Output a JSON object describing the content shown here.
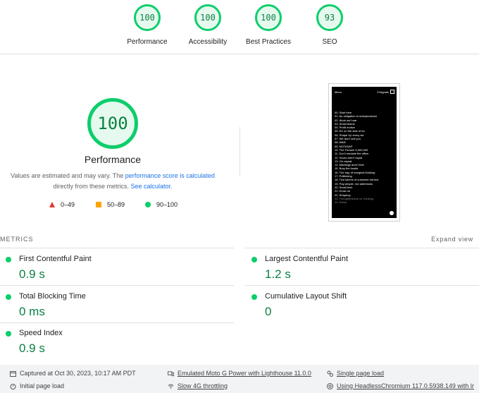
{
  "categories": [
    {
      "score": "100",
      "label": "Performance"
    },
    {
      "score": "100",
      "label": "Accessibility"
    },
    {
      "score": "100",
      "label": "Best Practices"
    },
    {
      "score": "93",
      "label": "SEO"
    }
  ],
  "performance": {
    "score": "100",
    "title": "Performance",
    "disclaimer_pre": "Values are estimated and may vary. The ",
    "disclaimer_link1": "performance score is calculated",
    "disclaimer_mid": " directly from these metrics. ",
    "disclaimer_link2": "See calculator.",
    "legend": [
      {
        "range": "0–49",
        "color": "#e53935"
      },
      {
        "range": "50–89",
        "color": "#ffa400"
      },
      {
        "range": "90–100",
        "color": "#0cce6b"
      }
    ]
  },
  "screenshot": {
    "menu": "Menu",
    "brand": "37signals",
    "items": [
      "00. Start here",
      "01. An obligation to independence",
      "02. Work isn't war",
      "03. Small teams",
      "04. Profit motive",
      "05. Err on the side of do",
      "06. Shape Up every six",
      "07. We don't sell you",
      "08. 8/8/8",
      "09. NOTASAP",
      "10. The Fortune 5,000,000",
      "11. Don't emulate the office",
      "12. Hours aren't equal",
      "13. On repeat",
      "14. Meetings aren't free",
      "15. Bury the hustle",
      "16. The trap of marginal thinking",
      "17. Politicking",
      "18. Two tokens of customer service",
      "19. Pay people, not addresses",
      "20. Small tech",
      "21. Know no",
      "22. Shapeup",
      "23. Thoughtfulness vs. thinking",
      "24. Dress"
    ]
  },
  "metrics": {
    "title": "METRICS",
    "expand": "Expand view",
    "items": [
      {
        "name": "First Contentful Paint",
        "value": "0.9 s"
      },
      {
        "name": "Largest Contentful Paint",
        "value": "1.2 s"
      },
      {
        "name": "Total Blocking Time",
        "value": "0 ms"
      },
      {
        "name": "Cumulative Layout Shift",
        "value": "0"
      },
      {
        "name": "Speed Index",
        "value": "0.9 s"
      }
    ]
  },
  "footer": {
    "captured": "Captured at Oct 30, 2023, 10:17 AM PDT",
    "initial_load": "Initial page load",
    "emulated": "Emulated Moto G Power with Lighthouse 11.0.0",
    "throttling": "Slow 4G throttling",
    "session": "Single page load",
    "browser": "Using HeadlessChromium 117.0.5938.149 with lr"
  }
}
